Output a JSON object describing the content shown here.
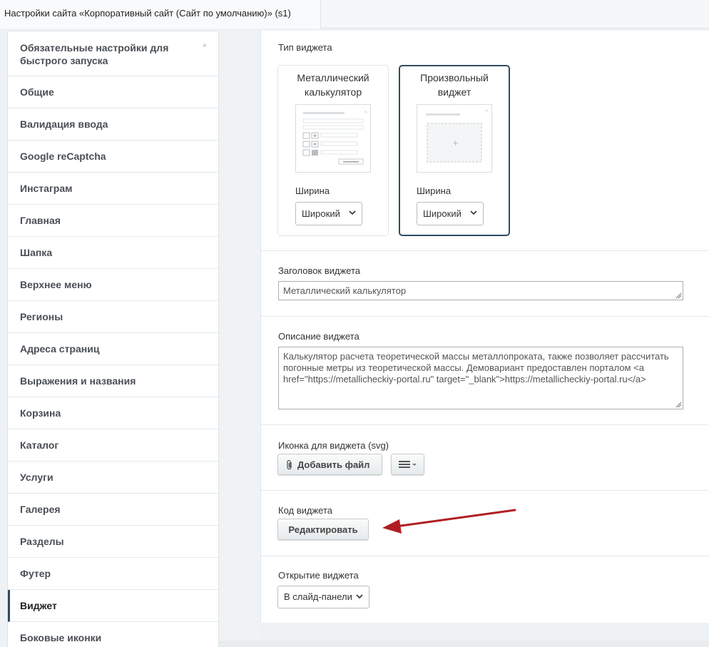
{
  "tab": {
    "title": "Настройки сайта «Корпоративный сайт (Сайт по умолчанию)» (s1)"
  },
  "sidebar": {
    "items": [
      {
        "label": "Обязательные настройки для быстрого запуска",
        "star": "*"
      },
      {
        "label": "Общие"
      },
      {
        "label": "Валидация ввода"
      },
      {
        "label": "Google reCaptcha"
      },
      {
        "label": "Инстаграм"
      },
      {
        "label": "Главная"
      },
      {
        "label": "Шапка"
      },
      {
        "label": "Верхнее меню"
      },
      {
        "label": "Регионы"
      },
      {
        "label": "Адреса страниц"
      },
      {
        "label": "Выражения и названия"
      },
      {
        "label": "Корзина"
      },
      {
        "label": "Каталог"
      },
      {
        "label": "Услуги"
      },
      {
        "label": "Галерея"
      },
      {
        "label": "Разделы"
      },
      {
        "label": "Футер"
      },
      {
        "label": "Виджет",
        "active": true
      },
      {
        "label": "Боковые иконки"
      }
    ]
  },
  "widget_type": {
    "label": "Тип виджета",
    "cards": [
      {
        "title_line1": "Металлический",
        "title_line2": "калькулятор",
        "width_label": "Ширина",
        "width_value": "Широкий",
        "selected": false
      },
      {
        "title_line1": "Произвольный",
        "title_line2": "виджет",
        "width_label": "Ширина",
        "width_value": "Широкий",
        "selected": true
      }
    ]
  },
  "widget_title": {
    "label": "Заголовок виджета",
    "value": "Металлический калькулятор"
  },
  "widget_description": {
    "label": "Описание виджета",
    "value": "Калькулятор расчета теоретической массы металлопроката, также позволяет рассчитать погонные метры из теоретической массы. Демовариант предоставлен порталом <a href=\"https://metallicheckiy-portal.ru\" target=\"_blank\">https://metallicheckiy-portal.ru</a>"
  },
  "widget_icon": {
    "label": "Иконка для виджета (svg)",
    "add_file": "Добавить файл"
  },
  "widget_code": {
    "label": "Код виджета",
    "edit": "Редактировать"
  },
  "widget_open": {
    "label": "Открытие виджета",
    "value": "В слайд-панели"
  },
  "colors": {
    "accent": "#2f4a64",
    "arrow": "#b01e23"
  }
}
